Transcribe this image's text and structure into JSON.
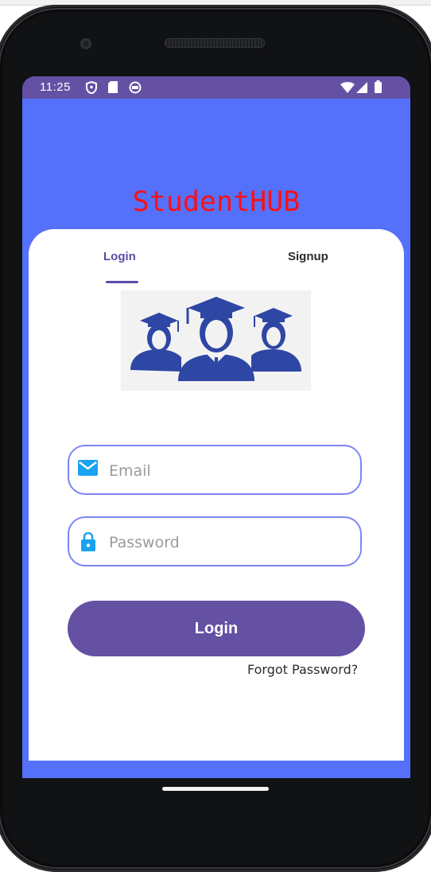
{
  "status_bar": {
    "time": "11:25",
    "left_icons": [
      "shield-icon",
      "sd-card-icon",
      "sync-icon"
    ],
    "right_icons": [
      "wifi-icon",
      "signal-icon",
      "battery-icon"
    ]
  },
  "app": {
    "title": "StudentHUB"
  },
  "tabs": [
    {
      "label": "Login",
      "active": true
    },
    {
      "label": "Signup",
      "active": false
    }
  ],
  "form": {
    "email": {
      "placeholder": "Email",
      "value": "",
      "icon": "mail-icon"
    },
    "password": {
      "placeholder": "Password",
      "value": "",
      "icon": "lock-icon"
    },
    "login_label": "Login",
    "forgot_label": "Forgot Password?"
  },
  "colors": {
    "status_bar": "#6451a4",
    "background": "#5570fa",
    "title": "#ff0f14",
    "accent": "#5a4da8",
    "field_border": "#7c86f2",
    "icon": "#1aa2f0",
    "illustration": "#2e46a4"
  }
}
